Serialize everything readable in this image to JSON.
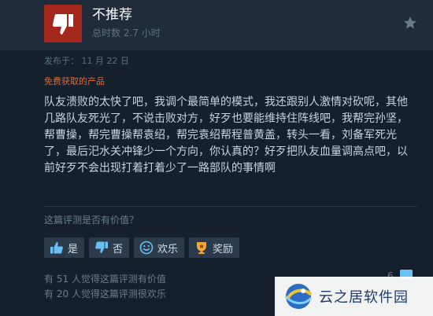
{
  "review": {
    "verdict": "不推荐",
    "hours": "总时数 2.7 小时",
    "posted": "发布于： 11 月 22 日",
    "product_label": "免费获取的产品",
    "body": "队友溃败的太快了吧，我调个最简单的模式，我还跟别人激情对砍呢，其他几路队友死光了，不说击败对方，好歹也要能维持住阵线吧，我帮完孙坚，帮曹操，帮完曹操帮袁绍，帮完袁绍帮程普黄盖，转头一看，刘备军死光了，最后汜水关冲锋少一个方向，你认真的？好歹把队友血量调高点吧，以前好歹不会出现打着打着少了一路部队的事情啊"
  },
  "helpful": {
    "question": "这篇评测是否有价值？",
    "buttons": {
      "yes": "是",
      "no": "否",
      "funny": "欢乐",
      "award": "奖励"
    },
    "helpful_count": "有 51 人觉得这篇评测有价值",
    "funny_count": "有 20 人觉得这篇评测很欢乐",
    "comment_count": "6"
  },
  "watermark": {
    "text": "云之居软件园",
    "icon": "globe-swirl-logo"
  },
  "colors": {
    "thumbs_down_bg": "#a3271a",
    "accent_orange": "#e6692b",
    "body_text": "#c6d4df"
  },
  "icons": {
    "verdict": "thumbs-down-icon",
    "favorite": "star-icon",
    "yes": "thumbs-up-icon",
    "no": "thumbs-down-icon",
    "funny": "smiley-icon",
    "award": "award-icon",
    "comment": "comment-icon"
  }
}
